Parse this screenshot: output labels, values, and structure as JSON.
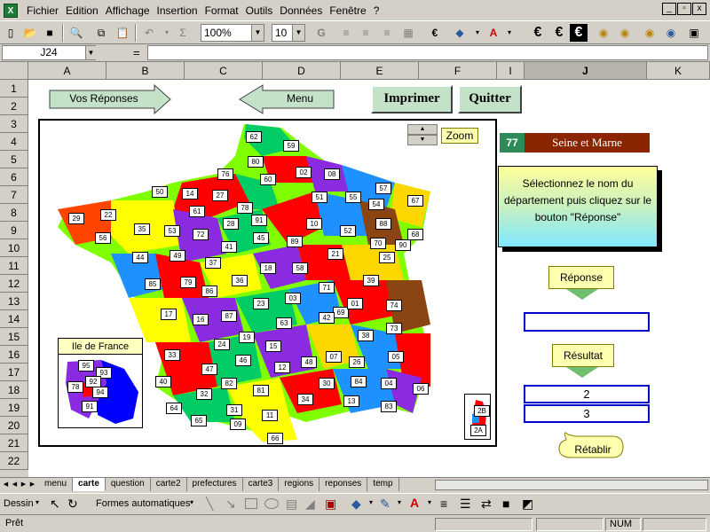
{
  "menubar": {
    "app_icon": "X",
    "items": [
      "Fichier",
      "Edition",
      "Affichage",
      "Insertion",
      "Format",
      "Outils",
      "Données",
      "Fenêtre",
      "?"
    ],
    "window_controls": [
      "_",
      "▫",
      "x"
    ]
  },
  "toolbar": {
    "zoom": "100%",
    "font_size": "10",
    "buttons": [
      "new-icon",
      "open-icon",
      "save-icon",
      "print-preview-icon",
      "copy-icon",
      "paste-icon",
      "undo-icon",
      "sum-icon",
      "bold-icon",
      "align-left-icon",
      "align-center-icon",
      "align-right-icon",
      "merge-icon",
      "euro-icon",
      "fill-color-icon",
      "font-color-icon",
      "euro-convert-icon"
    ]
  },
  "formula_bar": {
    "name_box": "J24",
    "equals": "=",
    "value": ""
  },
  "grid": {
    "columns": [
      "A",
      "B",
      "C",
      "D",
      "E",
      "F",
      "I",
      "J",
      "K"
    ],
    "selected_column": "J",
    "rows": [
      "1",
      "2",
      "3",
      "4",
      "5",
      "6",
      "7",
      "8",
      "9",
      "10",
      "11",
      "12",
      "13",
      "14",
      "15",
      "16",
      "17",
      "18",
      "19",
      "20",
      "21",
      "22"
    ]
  },
  "sheet": {
    "vos_reponses_label": "Vos Réponses",
    "menu_label": "Menu",
    "imprimer_label": "Imprimer",
    "quitter_label": "Quitter",
    "zoom_label": "Zoom",
    "idf_title": "Ile de France",
    "dept_number": "77",
    "dept_name": "Seine et Marne",
    "instruction": "Sélectionnez le nom du département puis cliquez sur le bouton \"Réponse\"",
    "reponse_label": "Réponse",
    "reponse_value": "",
    "resultat_label": "Résultat",
    "result_1": "2",
    "result_2": "3",
    "retablir_label": "Rétablir",
    "departments": [
      "62",
      "59",
      "80",
      "76",
      "02",
      "08",
      "50",
      "14",
      "27",
      "60",
      "57",
      "55",
      "67",
      "29",
      "22",
      "61",
      "28",
      "78",
      "91",
      "51",
      "54",
      "88",
      "68",
      "56",
      "35",
      "53",
      "72",
      "45",
      "10",
      "52",
      "70",
      "90",
      "44",
      "49",
      "41",
      "37",
      "89",
      "21",
      "25",
      "85",
      "79",
      "86",
      "36",
      "18",
      "58",
      "71",
      "39",
      "17",
      "16",
      "87",
      "23",
      "03",
      "69",
      "01",
      "74",
      "24",
      "19",
      "63",
      "15",
      "42",
      "38",
      "73",
      "33",
      "47",
      "46",
      "12",
      "48",
      "07",
      "26",
      "05",
      "40",
      "32",
      "82",
      "81",
      "30",
      "84",
      "04",
      "06",
      "64",
      "31",
      "65",
      "09",
      "11",
      "34",
      "13",
      "83",
      "66"
    ],
    "idf_departments": [
      "95",
      "93",
      "92",
      "78",
      "94",
      "91"
    ],
    "corsica": [
      "2B",
      "2A"
    ]
  },
  "tabs": {
    "items": [
      "menu",
      "carte",
      "question",
      "carte2",
      "prefectures",
      "carte3",
      "regions",
      "reponses",
      "temp"
    ],
    "active": "carte"
  },
  "drawbar": {
    "dessin": "Dessin",
    "formes": "Formes automatiques"
  },
  "status": {
    "ready": "Prêt",
    "num": "NUM"
  },
  "colors": {
    "button_green": "#c4e2c8",
    "dept_name_bg": "#8b2500",
    "dept_num_bg": "#2e8b57",
    "answer_border": "#0000cc"
  }
}
